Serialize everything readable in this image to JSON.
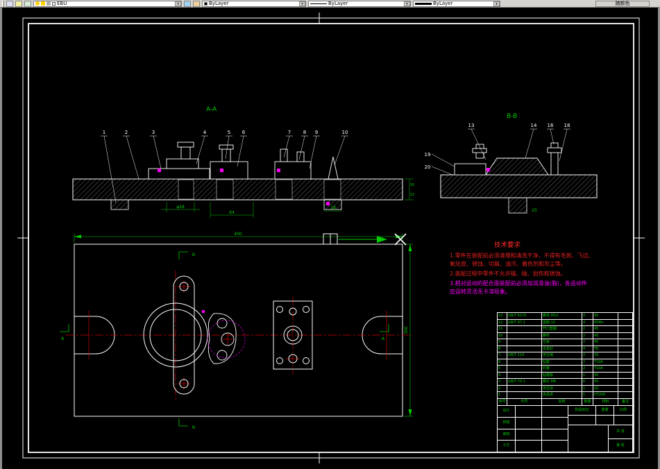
{
  "toolbar": {
    "layer_name": "EBU",
    "color_value": "ByLayer",
    "linetype_value": "ByLayer",
    "lineweight_value": "ByLayer",
    "plot_style_label": "随颜色",
    "icons": {
      "chevron_down": "▾"
    }
  },
  "drawing": {
    "section_a": {
      "label": "A-A",
      "parts": [
        "1",
        "2",
        "3",
        "4",
        "5",
        "6",
        "7",
        "8",
        "9",
        "10"
      ],
      "dim_phi18": "φ18",
      "dim_64": "64",
      "dim_18": "18",
      "dim_35": "35",
      "dim_12": "12"
    },
    "section_b": {
      "label": "B-B",
      "parts_top": [
        "13",
        "14",
        "16",
        "18"
      ],
      "parts_left": [
        "19",
        "20"
      ],
      "dim_25": "25"
    },
    "plan": {
      "dim_width": "400",
      "dim_height": "300",
      "mark_b_top": "B",
      "mark_b_bottom": "B",
      "mark_a_left": "A",
      "mark_a_right": "A"
    },
    "tech": {
      "title": "技术要求",
      "lines": [
        "1.零件在装配前必须清理和清洗干净，不得有毛刺、飞边、",
        "氧化皮、锈蚀、切屑、油污、着色剂和灰尘等。",
        "2.装配过程中零件不允许磕、碰、划伤和锈蚀。",
        "3.相对运动的配合面装配前必须加润滑油(脂)，各运动件",
        "应运转灵活无卡滞现象。"
      ]
    }
  },
  "title_block": {
    "parts_header": [
      "序号",
      "代号",
      "名称",
      "数量",
      "材料",
      "备注"
    ],
    "parts": [
      [
        "13",
        "GB/T 6170",
        "螺母 M12",
        "4",
        "45",
        ""
      ],
      [
        "12",
        "GB/T 97.1",
        "垫圈 12",
        "4",
        "65Mn",
        ""
      ],
      [
        "11",
        "",
        "开口垫圈",
        "2",
        "45",
        ""
      ],
      [
        "10",
        "",
        "螺杆",
        "2",
        "45",
        ""
      ],
      [
        "9",
        "",
        "压板",
        "2",
        "45",
        ""
      ],
      [
        "8",
        "",
        "支承钉",
        "4",
        "T8",
        ""
      ],
      [
        "7",
        "GB/T 119",
        "定位销",
        "2",
        "35",
        ""
      ],
      [
        "6",
        "",
        "钻套",
        "2",
        "T10A",
        ""
      ],
      [
        "5",
        "",
        "衬套",
        "2",
        "T10A",
        ""
      ],
      [
        "4",
        "",
        "钻模板",
        "1",
        "45",
        ""
      ],
      [
        "3",
        "GB/T 70.1",
        "螺钉 M8",
        "6",
        "45",
        ""
      ],
      [
        "2",
        "",
        "定位块",
        "1",
        "20",
        ""
      ],
      [
        "1",
        "",
        "夹具体",
        "1",
        "HT200",
        ""
      ]
    ],
    "fields": {
      "row1": "设计",
      "row2": "校核",
      "row3": "审核",
      "row4": "工艺",
      "stage": "阶段标记",
      "weight": "重量",
      "scale": "比例",
      "sheet_total": "共 张",
      "sheet_no": "第 张"
    }
  },
  "colors": {
    "accent_green": "#00cc00",
    "accent_red": "#e62020",
    "accent_magenta": "#ff00ff",
    "canvas_bg": "#000000"
  }
}
